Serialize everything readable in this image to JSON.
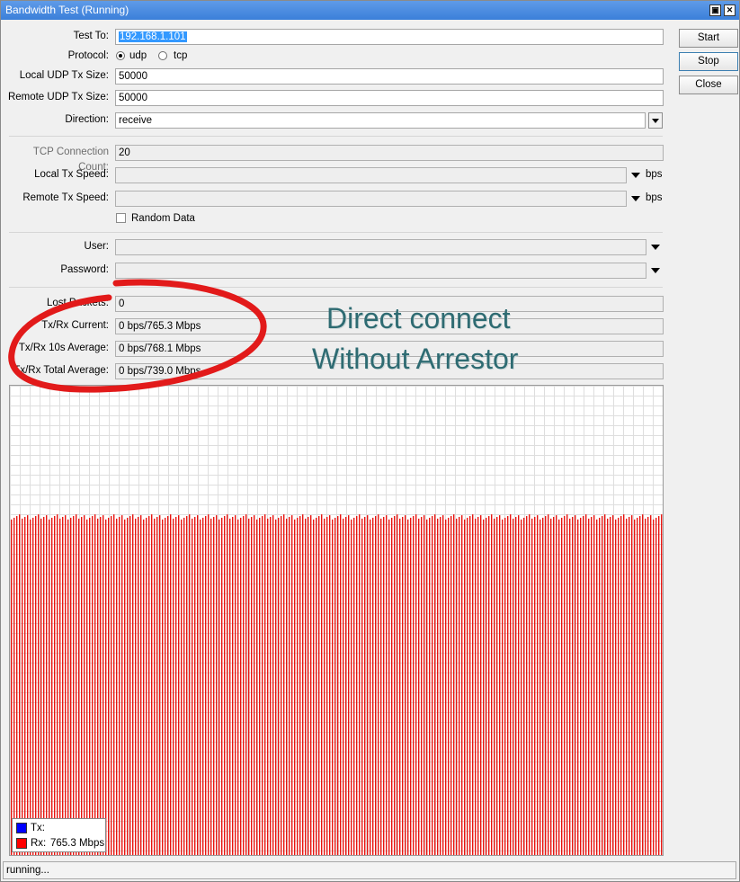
{
  "window": {
    "title": "Bandwidth Test (Running)",
    "restore_glyph": "▣",
    "close_glyph": "✕"
  },
  "form": {
    "test_to": {
      "label": "Test To:",
      "value": "192.168.1.101"
    },
    "protocol": {
      "label": "Protocol:",
      "options": [
        "udp",
        "tcp"
      ],
      "selected": "udp"
    },
    "local_udp_tx_size": {
      "label": "Local UDP Tx Size:",
      "value": "50000"
    },
    "remote_udp_tx_size": {
      "label": "Remote UDP Tx Size:",
      "value": "50000"
    },
    "direction": {
      "label": "Direction:",
      "value": "receive"
    },
    "tcp_connection_count": {
      "label": "TCP Connection Count:",
      "value": "20"
    },
    "local_tx_speed": {
      "label": "Local Tx Speed:",
      "value": "",
      "unit": "bps"
    },
    "remote_tx_speed": {
      "label": "Remote Tx Speed:",
      "value": "",
      "unit": "bps"
    },
    "random_data": {
      "label": "Random Data",
      "checked": false
    },
    "user": {
      "label": "User:",
      "value": ""
    },
    "password": {
      "label": "Password:",
      "value": ""
    }
  },
  "stats": {
    "lost_packets": {
      "label": "Lost Packets:",
      "value": "0"
    },
    "txrx_current": {
      "label": "Tx/Rx Current:",
      "value": "0 bps/765.3 Mbps"
    },
    "txrx_10s_average": {
      "label": "Tx/Rx 10s Average:",
      "value": "0 bps/768.1 Mbps"
    },
    "txrx_total_average": {
      "label": "Tx/Rx Total Average:",
      "value": "0 bps/739.0 Mbps"
    }
  },
  "buttons": {
    "start": "Start",
    "stop": "Stop",
    "close": "Close"
  },
  "annotation": {
    "line1": "Direct connect",
    "line2": "Without Arrestor"
  },
  "chart_data": {
    "type": "bar",
    "series": [
      {
        "name": "Tx",
        "color": "#0000ff",
        "legend_label": "Tx:",
        "current": "",
        "level": 0.0
      },
      {
        "name": "Rx",
        "color": "#ff0000",
        "legend_label": "Rx:",
        "current": "765.3 Mbps",
        "level": 0.72
      }
    ],
    "grid": true,
    "legend_position": "bottom-left"
  },
  "status": {
    "text": "running..."
  },
  "colors": {
    "title_bar": "#3b7fd9",
    "rx_bar": "#e8140f",
    "annotation_circle": "#e21a1a",
    "annotation_text": "#2e6b72"
  }
}
